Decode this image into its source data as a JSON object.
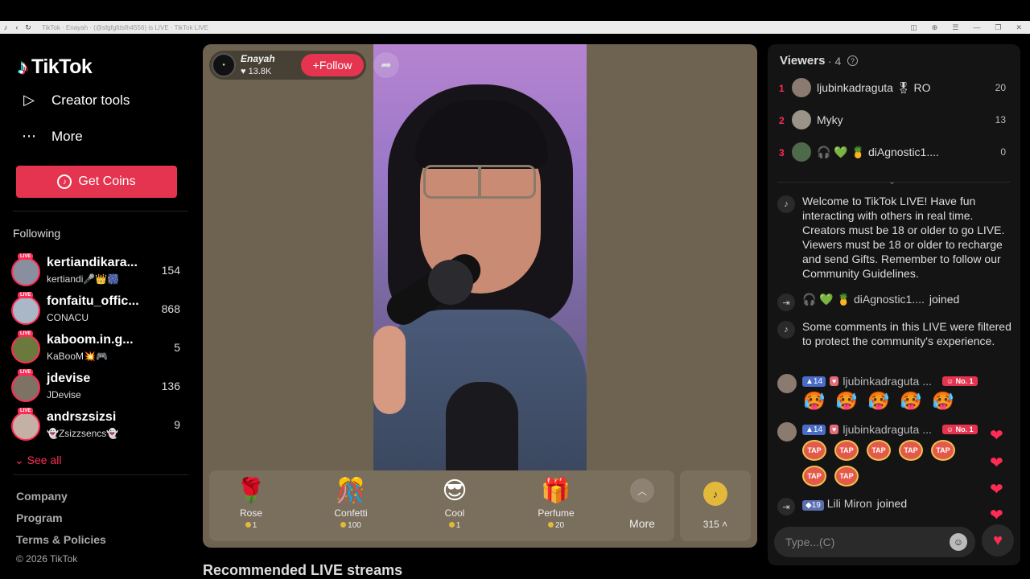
{
  "browser": {
    "url": "TikTok · Enayah · (@sfgfgfdsfh4556) is LIVE · TikTok LIVE"
  },
  "sidebar": {
    "logo": "TikTok",
    "nav": [
      {
        "label": "Creator tools",
        "icon": "play-square-icon"
      },
      {
        "label": "More",
        "icon": "more-dots-icon"
      }
    ],
    "coins_button": "Get Coins",
    "following_title": "Following",
    "following": [
      {
        "name": "kertiandikara...",
        "sub": "kertiandi🎤👑🎆",
        "count": "154"
      },
      {
        "name": "fonfaitu_offic...",
        "sub": "CONACU",
        "count": "868"
      },
      {
        "name": "kaboom.in.g...",
        "sub": "KaBooM💥🎮",
        "count": "5"
      },
      {
        "name": "jdevise",
        "sub": "JDevise",
        "count": "136"
      },
      {
        "name": "andrszsizsi",
        "sub": "👻Zsizzsencs👻",
        "count": "9"
      }
    ],
    "live_tag": "LIVE",
    "see_all": "See all",
    "footer_links": [
      "Company",
      "Program",
      "Terms & Policies"
    ],
    "copyright": "© 2026 TikTok"
  },
  "stream": {
    "host_name": "Enayah",
    "host_likes": "13.8K",
    "follow_label": "Follow",
    "gifts": [
      {
        "name": "Rose",
        "price": "1",
        "icon": "🌹"
      },
      {
        "name": "Confetti",
        "price": "100",
        "icon": "🎊"
      },
      {
        "name": "Cool",
        "price": "1",
        "icon": "😎"
      },
      {
        "name": "Perfume",
        "price": "20",
        "icon": "🎁"
      }
    ],
    "more_label": "More",
    "coin_balance": "315"
  },
  "recommended_title": "Recommended LIVE streams",
  "chat": {
    "viewers_title": "Viewers",
    "viewers_count": "· 4",
    "viewers": [
      {
        "rank": "1",
        "name": "ljubinkadraguta 🎖 RO",
        "score": "20"
      },
      {
        "rank": "2",
        "name": "Myky",
        "score": "13"
      },
      {
        "rank": "3",
        "name": "🎧 💚 🍍 diAgnostic1....",
        "score": "0"
      }
    ],
    "welcome": "Welcome to TikTok LIVE! Have fun interacting with others in real time. Creators must be 18 or older to go LIVE. Viewers must be 18 or older to recharge and send Gifts. Remember to follow our Community Guidelines.",
    "join1_name": "🎧 💚 🍍 diAgnostic1....",
    "joined_label": "joined",
    "filter_notice": "Some comments in this LIVE were filtered to protect the community's experience.",
    "comments": [
      {
        "level": "14",
        "name": "ljubinkadraguta ...",
        "rank_badge": "No. 1"
      },
      {
        "level": "14",
        "name": "ljubinkadraguta ...",
        "rank_badge": "No. 1"
      }
    ],
    "tap_label": "TAP",
    "join2_level": "19",
    "join2_name": "Lili Miron",
    "input_placeholder": "Type...(C)"
  },
  "colors": {
    "brand_pink": "#fe2c55",
    "coins_button": "#e5344f",
    "coin_gold": "#e2b93b"
  }
}
